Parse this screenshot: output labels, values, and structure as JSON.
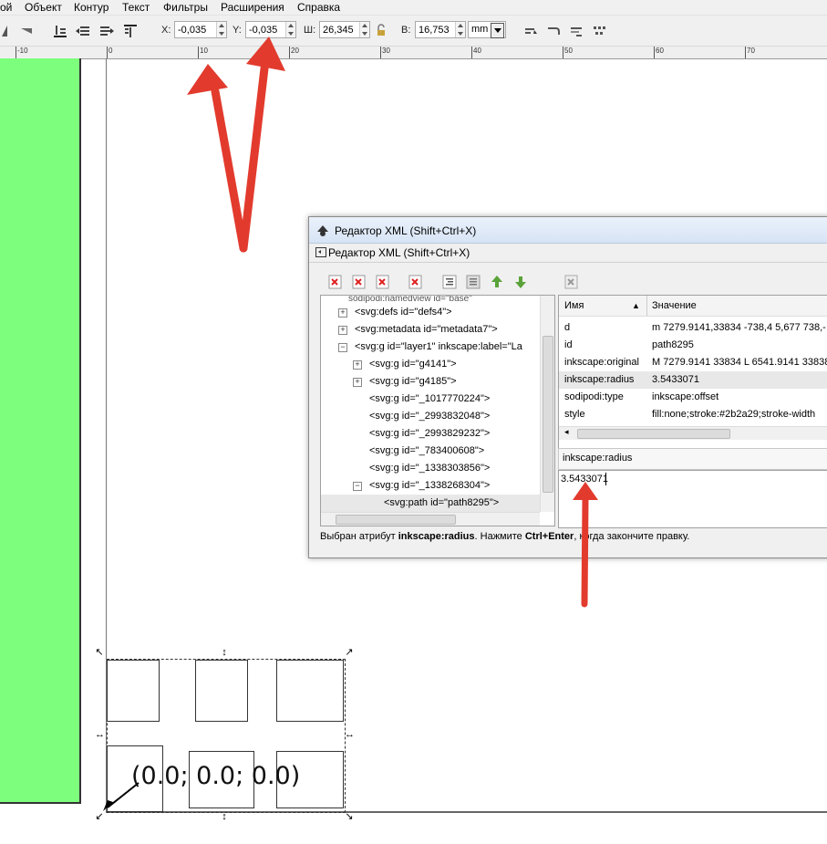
{
  "menu": [
    "ой",
    "Объект",
    "Контур",
    "Текст",
    "Фильтры",
    "Расширения",
    "Справка"
  ],
  "toolbar": {
    "x_label": "X:",
    "x_value": "-0,035",
    "y_label": "Y:",
    "y_value": "-0,035",
    "w_label": "Ш:",
    "w_value": "26,345",
    "h_label": "В:",
    "h_value": "16,753",
    "unit": "mm",
    "icons": [
      "align-bottom-icon",
      "lower-icon",
      "raise-icon",
      "align-top-icon",
      "lock-icon",
      "transform-scale-icon",
      "transform-radius-icon",
      "transform-gradient-icon",
      "transform-pattern-icon"
    ]
  },
  "ruler": {
    "labels": [
      "-10",
      "0",
      "10",
      "20",
      "30",
      "40",
      "50",
      "60",
      "70"
    ]
  },
  "canvas": {
    "coords_text": "(0.0; 0.0; 0.0)"
  },
  "xml_editor": {
    "title": "Редактор XML (Shift+Ctrl+X)",
    "subtitle": "Редактор XML (Shift+Ctrl+X)",
    "nodes": [
      {
        "text": "<svg:defs id=\"defs4\">",
        "expander": "+",
        "level": 0
      },
      {
        "text": "<svg:metadata id=\"metadata7\">",
        "expander": "+",
        "level": 0
      },
      {
        "text": "<svg:g id=\"layer1\" inkscape:label=\"La",
        "expander": "−",
        "level": 0
      },
      {
        "text": "<svg:g id=\"g4141\">",
        "expander": "+",
        "level": 1
      },
      {
        "text": "<svg:g id=\"g4185\">",
        "expander": "+",
        "level": 1
      },
      {
        "text": "<svg:g id=\"_1017770224\">",
        "expander": "",
        "level": 1
      },
      {
        "text": "<svg:g id=\"_2993832048\">",
        "expander": "",
        "level": 1
      },
      {
        "text": "<svg:g id=\"_2993829232\">",
        "expander": "",
        "level": 1
      },
      {
        "text": "<svg:g id=\"_783400608\">",
        "expander": "",
        "level": 1
      },
      {
        "text": "<svg:g id=\"_1338303856\">",
        "expander": "",
        "level": 1
      },
      {
        "text": "<svg:g id=\"_1338268304\">",
        "expander": "−",
        "level": 1
      },
      {
        "text": "<svg:path id=\"path8295\">",
        "expander": "",
        "level": 2,
        "selected": true
      }
    ],
    "attr_header": {
      "name": "Имя",
      "value": "Значение"
    },
    "attributes": [
      {
        "name": "d",
        "value": "m 7279.9141,33834 -738,4 5,677 738,-"
      },
      {
        "name": "id",
        "value": "path8295"
      },
      {
        "name": "inkscape:original",
        "value": "M 7279.9141 33834 L 6541.9141 33838"
      },
      {
        "name": "inkscape:radius",
        "value": "3.5433071",
        "selected": true
      },
      {
        "name": "sodipodi:type",
        "value": "inkscape:offset"
      },
      {
        "name": "style",
        "value": "fill:none;stroke:#2b2a29;stroke-width"
      }
    ],
    "selected_attr_name": "inkscape:radius",
    "selected_attr_value": "3.5433071",
    "status_prefix": "Выбран атрибут ",
    "status_attr": "inkscape:radius",
    "status_mid": ". Нажмите ",
    "status_keys": "Ctrl+Enter",
    "status_suffix": ", когда закончите правку."
  },
  "colors": {
    "page_green": "#7dff7d",
    "arrow_red": "#e23b2e",
    "selection_bg": "#e8e8e8"
  }
}
